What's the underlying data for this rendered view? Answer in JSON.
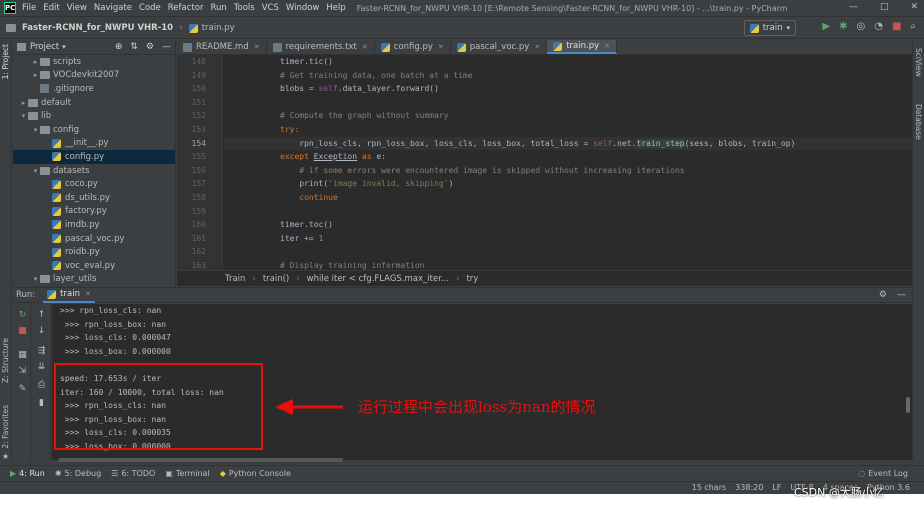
{
  "menu": [
    "File",
    "Edit",
    "View",
    "Navigate",
    "Code",
    "Refactor",
    "Run",
    "Tools",
    "VCS",
    "Window",
    "Help"
  ],
  "window_title": "Faster-RCNN_for_NWPU VHR-10 [E:\\Remote Sensing\\Faster-RCNN_for_NWPU VHR-10] - ...\\train.py - PyCharm",
  "nav": {
    "project": "Faster-RCNN_for_NWPU VHR-10",
    "file": "train.py",
    "run_config": "train"
  },
  "left_strip": {
    "project": "1: Project",
    "structure": "Z: Structure",
    "favorites": "2: Favorites"
  },
  "right_strip": {
    "sciview": "SciView",
    "database": "Database"
  },
  "project_panel": {
    "title": "Project"
  },
  "tree": [
    {
      "label": "scripts",
      "type": "folder",
      "indent": 2,
      "arrow": "▸"
    },
    {
      "label": "VOCdevkit2007",
      "type": "folder",
      "indent": 2,
      "arrow": "▸"
    },
    {
      "label": ".gitignore",
      "type": "git",
      "indent": 2,
      "arrow": ""
    },
    {
      "label": "default",
      "type": "folder",
      "indent": 1,
      "arrow": "▸"
    },
    {
      "label": "lib",
      "type": "folder",
      "indent": 1,
      "arrow": "▾"
    },
    {
      "label": "config",
      "type": "folder",
      "indent": 2,
      "arrow": "▾"
    },
    {
      "label": "__init__.py",
      "type": "py",
      "indent": 3,
      "arrow": ""
    },
    {
      "label": "config.py",
      "type": "py",
      "indent": 3,
      "arrow": "",
      "selected": true
    },
    {
      "label": "datasets",
      "type": "folder",
      "indent": 2,
      "arrow": "▾"
    },
    {
      "label": "coco.py",
      "type": "py",
      "indent": 3,
      "arrow": ""
    },
    {
      "label": "ds_utils.py",
      "type": "py",
      "indent": 3,
      "arrow": ""
    },
    {
      "label": "factory.py",
      "type": "py",
      "indent": 3,
      "arrow": ""
    },
    {
      "label": "imdb.py",
      "type": "py",
      "indent": 3,
      "arrow": ""
    },
    {
      "label": "pascal_voc.py",
      "type": "py",
      "indent": 3,
      "arrow": ""
    },
    {
      "label": "roidb.py",
      "type": "py",
      "indent": 3,
      "arrow": ""
    },
    {
      "label": "voc_eval.py",
      "type": "py",
      "indent": 3,
      "arrow": ""
    },
    {
      "label": "layer_utils",
      "type": "folder",
      "indent": 2,
      "arrow": "▾"
    }
  ],
  "tabs": [
    {
      "label": "README.md",
      "active": false
    },
    {
      "label": "requirements.txt",
      "active": false
    },
    {
      "label": "config.py",
      "active": false
    },
    {
      "label": "pascal_voc.py",
      "active": false
    },
    {
      "label": "train.py",
      "active": true
    }
  ],
  "code": {
    "line_numbers": [
      "148",
      "149",
      "150",
      "151",
      "152",
      "153",
      "154",
      "155",
      "156",
      "157",
      "158",
      "159",
      "160",
      "161",
      "162",
      "163"
    ],
    "current_line_index": 6,
    "l148": "timer.tic()",
    "l149": "# Get training data, one batch at a time",
    "l150a": "blobs = ",
    "l150b": "self",
    "l150c": ".data_layer.forward()",
    "l152": "# Compute the graph without summary",
    "l153": "try:",
    "l154a": "rpn_loss_cls, rpn_loss_box, loss_cls, loss_box, total_loss = ",
    "l154b": "self",
    "l154c": ".net.",
    "l154d": "train_step",
    "l154e": "(sess, blobs, train_op)",
    "l155a": "except ",
    "l155b": "Exception",
    "l155c": " as ",
    "l155d": "e:",
    "l156": "# if some errors were encountered image is skipped without increasing iterations",
    "l157a": "print(",
    "l157b": "'image invalid, skipping'",
    "l157c": ")",
    "l158": "continue",
    "l160": "timer.toc()",
    "l161a": "iter += ",
    "l161b": "1",
    "l163": "# Display training information"
  },
  "breadcrumb": [
    "Train",
    "train()",
    "while iter < cfg.FLAGS.max_iter...",
    "try"
  ],
  "run_panel": {
    "label": "Run:",
    "tab": "train"
  },
  "console_lines": [
    ">>> rpn_loss_cls: nan",
    " >>> rpn_loss_box: nan",
    " >>> loss_cls: 0.000047",
    " >>> loss_box: 0.000000",
    "",
    "speed: 17.653s / iter",
    "iter: 160 / 10000, total loss: nan",
    " >>> rpn_loss_cls: nan",
    " >>> rpn_loss_box: nan",
    " >>> loss_cls: 0.000035",
    " >>> loss_box: 0.000000"
  ],
  "annotation": "运行过程中会出现loss为nan的情况",
  "annotation_color": "#e8100e",
  "bottom_tools": [
    {
      "label": "4: Run",
      "icon": "run-icon",
      "active": true
    },
    {
      "label": "5: Debug",
      "icon": "bug-icon",
      "active": false
    },
    {
      "label": "6: TODO",
      "icon": "list-icon",
      "active": false
    },
    {
      "label": "Terminal",
      "icon": "terminal-icon",
      "active": false
    },
    {
      "label": "Python Console",
      "icon": "python-icon",
      "active": false
    }
  ],
  "event_log": "Event Log",
  "status": [
    "15 chars",
    "338:20",
    "LF",
    "UTF-8",
    "4 spaces",
    "Python 3.6"
  ],
  "watermark": "CSDN @大肠小忆"
}
